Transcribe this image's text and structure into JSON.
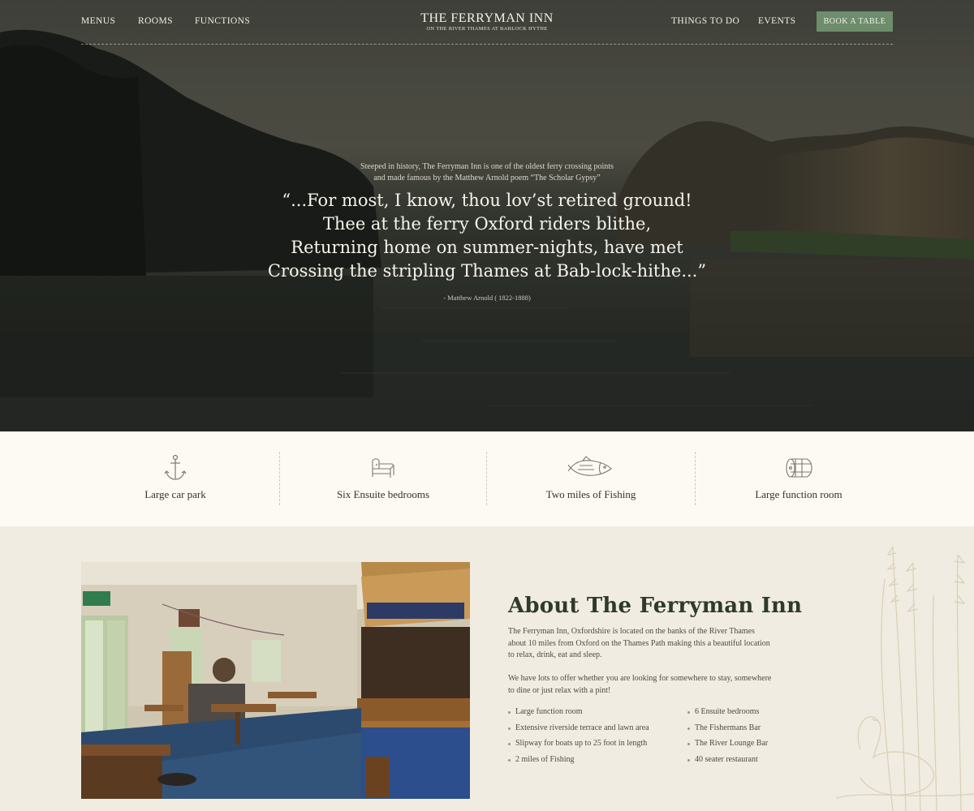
{
  "nav": {
    "left": [
      "MENUS",
      "ROOMS",
      "FUNCTIONS"
    ],
    "right": [
      "THINGS TO DO",
      "EVENTS"
    ],
    "brand_title": "THE FERRYMAN INN",
    "brand_subtitle": "ON THE RIVER THAMES AT BABLOCK HYTHE",
    "cta": "BOOK A TABLE"
  },
  "hero": {
    "intro_line1": "Steeped in history, The Ferryman Inn is one of the oldest ferry crossing points",
    "intro_line2": "and made famous by the Matthew Arnold poem “The Scholar Gypsy”",
    "quote_lines": [
      "“...For most, I know, thou lov’st retired ground!",
      "Thee at the ferry Oxford riders blithe,",
      "Returning home on summer-nights, have met",
      "Crossing the stripling Thames at Bab-lock-hithe...”"
    ],
    "attribution": "- Matthew Arnold ( 1822-1888)"
  },
  "features": [
    {
      "label": "Large car park",
      "icon": "anchor-icon"
    },
    {
      "label": "Six Ensuite bedrooms",
      "icon": "bed-icon"
    },
    {
      "label": "Two miles of Fishing",
      "icon": "fish-icon"
    },
    {
      "label": "Large function room",
      "icon": "barrel-icon"
    }
  ],
  "about": {
    "title": "About The Ferryman Inn",
    "p1_lines": [
      "The Ferryman Inn, Oxfordshire is located on the banks of the River Thames",
      "about 10 miles from Oxford on the Thames Path making this a beautiful location",
      "to relax, drink, eat and sleep."
    ],
    "p2_lines": [
      "We have lots to offer whether you are looking for somewhere to stay, somewhere",
      "to dine or just relax with a pint!"
    ],
    "list_left": [
      "Large function room",
      "Extensive riverside terrace and lawn area",
      "Slipway for boats up to 25 foot in length",
      "2 miles of Fishing"
    ],
    "list_right": [
      "6 Ensuite bedrooms",
      "The Fishermans Bar",
      "The River Lounge Bar",
      "40 seater restaurant"
    ]
  },
  "colors": {
    "accent_green": "#6d8d6c",
    "cream": "#fdfaf3",
    "beige": "#f1ece1",
    "title_green": "#2e3a2c"
  }
}
